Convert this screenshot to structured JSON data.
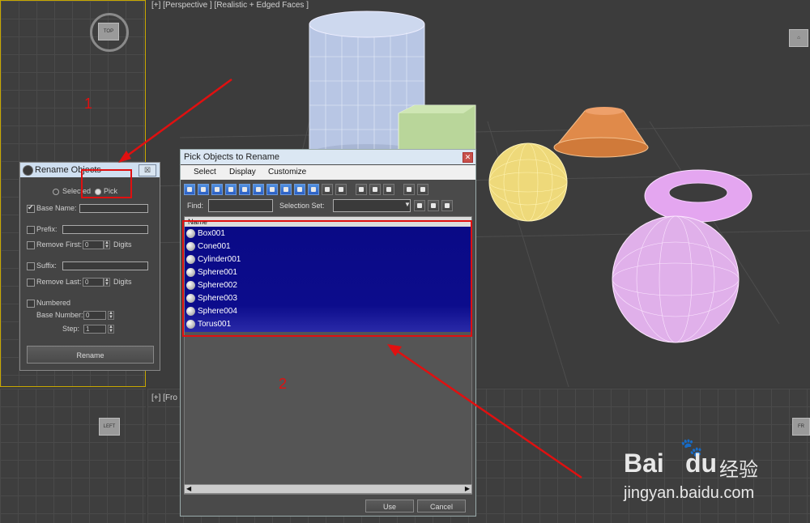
{
  "viewport_top": {
    "label": "[+] [Perspective ] [Realistic + Edged Faces ]"
  },
  "viewport_bottom": {
    "label": "[+] [Fro"
  },
  "rename_dialog": {
    "title": "Rename Objects",
    "close": "☒",
    "radio_selected": "Selected",
    "radio_pick": "Pick",
    "base_name_label": "Base Name:",
    "prefix_label": "Prefix:",
    "remove_first_label": "Remove First:",
    "remove_first_value": "0",
    "digits_label": "Digits",
    "suffix_label": "Suffix:",
    "remove_last_label": "Remove Last:",
    "remove_last_value": "0",
    "digits_label_2": "Digits",
    "numbered_label": "Numbered",
    "base_number_label": "Base Number:",
    "base_number_value": "0",
    "step_label": "Step:",
    "step_value": "1",
    "rename_button": "Rename"
  },
  "pick_dialog": {
    "title": "Pick Objects to Rename",
    "close": "✕",
    "menu": [
      "Select",
      "Display",
      "Customize"
    ],
    "find_label": "Find:",
    "selection_set_label": "Selection Set:",
    "column_header": "Name",
    "objects": [
      "Box001",
      "Cone001",
      "Cylinder001",
      "Sphere001",
      "Sphere002",
      "Sphere003",
      "Sphere004",
      "Torus001"
    ],
    "use_button": "Use",
    "cancel_button": "Cancel"
  },
  "annotations": {
    "one": "1",
    "two": "2"
  },
  "watermark": {
    "brand": "Bai",
    "brand2": "du",
    "cn": "经验",
    "url": "jingyan.baidu.com"
  },
  "colors": {
    "selection": "#0a0a86",
    "annotation": "#e01010",
    "titlebar": "#cfdff0"
  }
}
